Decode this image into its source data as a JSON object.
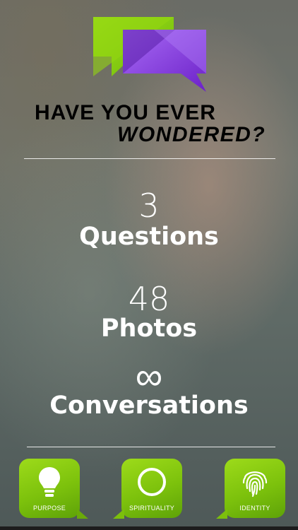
{
  "headline": {
    "line1": "HAVE YOU EVER",
    "line2": "WONDERED?"
  },
  "stats": [
    {
      "number": "3",
      "label": "Questions"
    },
    {
      "number": "48",
      "label": "Photos"
    },
    {
      "number": "∞",
      "label": "Conversations"
    }
  ],
  "tiles": [
    {
      "label": "PURPOSE",
      "icon": "lightbulb-icon"
    },
    {
      "label": "SPIRITUALITY",
      "icon": "circle-icon"
    },
    {
      "label": "IDENTITY",
      "icon": "fingerprint-icon"
    }
  ],
  "colors": {
    "green": "#8fd00f",
    "purple": "#8a3ee6",
    "text": "#ffffff"
  }
}
